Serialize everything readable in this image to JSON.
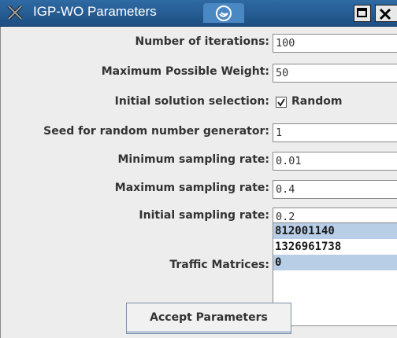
{
  "window": {
    "title": "IGP-WO Parameters",
    "icons": {
      "app": "x-app-icon",
      "tab": "swirl-icon",
      "maximize": "maximize-icon",
      "close": "close-icon"
    }
  },
  "form": {
    "iterations": {
      "label": "Number of iterations:",
      "value": "100"
    },
    "max_weight": {
      "label": "Maximum Possible Weight:",
      "value": "50"
    },
    "initial_solution": {
      "label": "Initial solution selection:",
      "checkbox_label": "Random",
      "checked": true
    },
    "seed": {
      "label": "Seed for random number generator:",
      "value": "1"
    },
    "min_rate": {
      "label": "Minimum sampling rate:",
      "value": "0.01"
    },
    "max_rate": {
      "label": "Maximum sampling rate:",
      "value": "0.4"
    },
    "init_rate": {
      "label": "Initial sampling rate:",
      "value": "0.2"
    },
    "traffic": {
      "label": "Traffic Matrices:",
      "items": [
        {
          "text": "812001140",
          "selected": true
        },
        {
          "text": "1326961738",
          "selected": false
        },
        {
          "text": "0",
          "selected": true
        }
      ]
    },
    "accept_button": "Accept Parameters"
  },
  "colors": {
    "titlebar": "#2f6aa4",
    "selection": "#b8cde6",
    "background": "#ededed"
  }
}
